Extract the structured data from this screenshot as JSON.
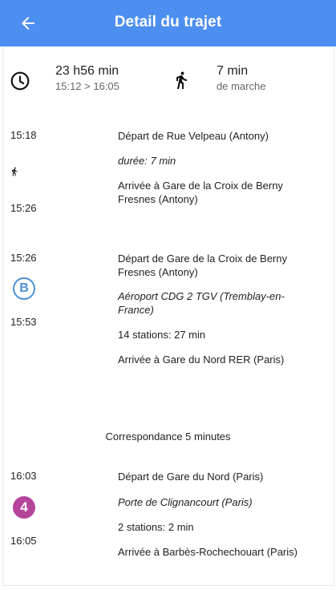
{
  "header": {
    "title": "Detail du trajet",
    "back_icon": "arrow-left-icon",
    "color": "#4d8ff0"
  },
  "summary": {
    "duration": "23 h56 min",
    "times": "15:12 > 16:05",
    "walk_duration": "7 min",
    "walk_label": "de marche"
  },
  "legs": [
    {
      "mode": "walk",
      "start_time": "15:18",
      "end_time": "15:26",
      "departure": "Départ de Rue Velpeau (Antony)",
      "info": "durée: 7 min",
      "arrival": "Arrivée à Gare de la Croix de Berny Fresnes (Antony)"
    },
    {
      "mode": "rer",
      "line": "B",
      "line_color": "#4d90d8",
      "start_time": "15:26",
      "end_time": "15:53",
      "departure": "Départ de Gare de la Croix de Berny Fresnes (Antony)",
      "direction": "Aéroport CDG 2 TGV (Tremblay-en-France)",
      "stops": "14 stations: 27 min",
      "arrival": "Arrivée à Gare du Nord RER (Paris)"
    },
    {
      "mode": "metro",
      "line": "4",
      "line_color": "#b5449b",
      "start_time": "16:03",
      "end_time": "16:05",
      "departure": "Départ de Gare du Nord (Paris)",
      "direction": "Porte de Clignancourt (Paris)",
      "stops": "2 stations: 2 min",
      "arrival": "Arrivée à Barbès-Rochechouart (Paris)"
    }
  ],
  "transfer": "Correspondance 5 minutes"
}
